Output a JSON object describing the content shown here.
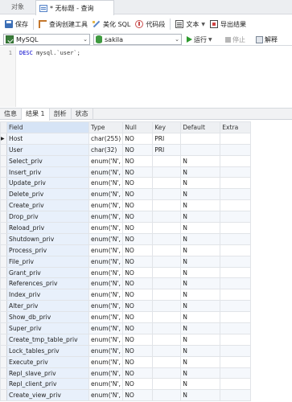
{
  "tabs": {
    "objects_label": "对象",
    "query_tab_label": "* 无标题 - 查询"
  },
  "toolbar": {
    "save": "保存",
    "query_builder": "查询创建工具",
    "beautify_sql": "美化 SQL",
    "code_snippet": "代码段",
    "text": "文本",
    "export_results": "导出结果"
  },
  "connection": {
    "connection_value": "MySQL",
    "database_value": "sakila",
    "run_label": "运行",
    "stop_label": "停止",
    "explain_label": "解释"
  },
  "editor": {
    "line_number": "1",
    "keyword": "DESC",
    "rest": " mysql.`user`;"
  },
  "result_tabs": [
    "信息",
    "结果 1",
    "剖析",
    "状态"
  ],
  "grid": {
    "columns": [
      "Field",
      "Type",
      "Null",
      "Key",
      "Default",
      "Extra"
    ],
    "rows": [
      [
        "Host",
        "char(255)",
        "NO",
        "PRI",
        "",
        ""
      ],
      [
        "User",
        "char(32)",
        "NO",
        "PRI",
        "",
        ""
      ],
      [
        "Select_priv",
        "enum('N',",
        "NO",
        "",
        "N",
        ""
      ],
      [
        "Insert_priv",
        "enum('N',",
        "NO",
        "",
        "N",
        ""
      ],
      [
        "Update_priv",
        "enum('N',",
        "NO",
        "",
        "N",
        ""
      ],
      [
        "Delete_priv",
        "enum('N',",
        "NO",
        "",
        "N",
        ""
      ],
      [
        "Create_priv",
        "enum('N',",
        "NO",
        "",
        "N",
        ""
      ],
      [
        "Drop_priv",
        "enum('N',",
        "NO",
        "",
        "N",
        ""
      ],
      [
        "Reload_priv",
        "enum('N',",
        "NO",
        "",
        "N",
        ""
      ],
      [
        "Shutdown_priv",
        "enum('N',",
        "NO",
        "",
        "N",
        ""
      ],
      [
        "Process_priv",
        "enum('N',",
        "NO",
        "",
        "N",
        ""
      ],
      [
        "File_priv",
        "enum('N',",
        "NO",
        "",
        "N",
        ""
      ],
      [
        "Grant_priv",
        "enum('N',",
        "NO",
        "",
        "N",
        ""
      ],
      [
        "References_priv",
        "enum('N',",
        "NO",
        "",
        "N",
        ""
      ],
      [
        "Index_priv",
        "enum('N',",
        "NO",
        "",
        "N",
        ""
      ],
      [
        "Alter_priv",
        "enum('N',",
        "NO",
        "",
        "N",
        ""
      ],
      [
        "Show_db_priv",
        "enum('N',",
        "NO",
        "",
        "N",
        ""
      ],
      [
        "Super_priv",
        "enum('N',",
        "NO",
        "",
        "N",
        ""
      ],
      [
        "Create_tmp_table_priv",
        "enum('N',",
        "NO",
        "",
        "N",
        ""
      ],
      [
        "Lock_tables_priv",
        "enum('N',",
        "NO",
        "",
        "N",
        ""
      ],
      [
        "Execute_priv",
        "enum('N',",
        "NO",
        "",
        "N",
        ""
      ],
      [
        "Repl_slave_priv",
        "enum('N',",
        "NO",
        "",
        "N",
        ""
      ],
      [
        "Repl_client_priv",
        "enum('N',",
        "NO",
        "",
        "N",
        ""
      ],
      [
        "Create_view_priv",
        "enum('N',",
        "NO",
        "",
        "N",
        ""
      ]
    ]
  }
}
